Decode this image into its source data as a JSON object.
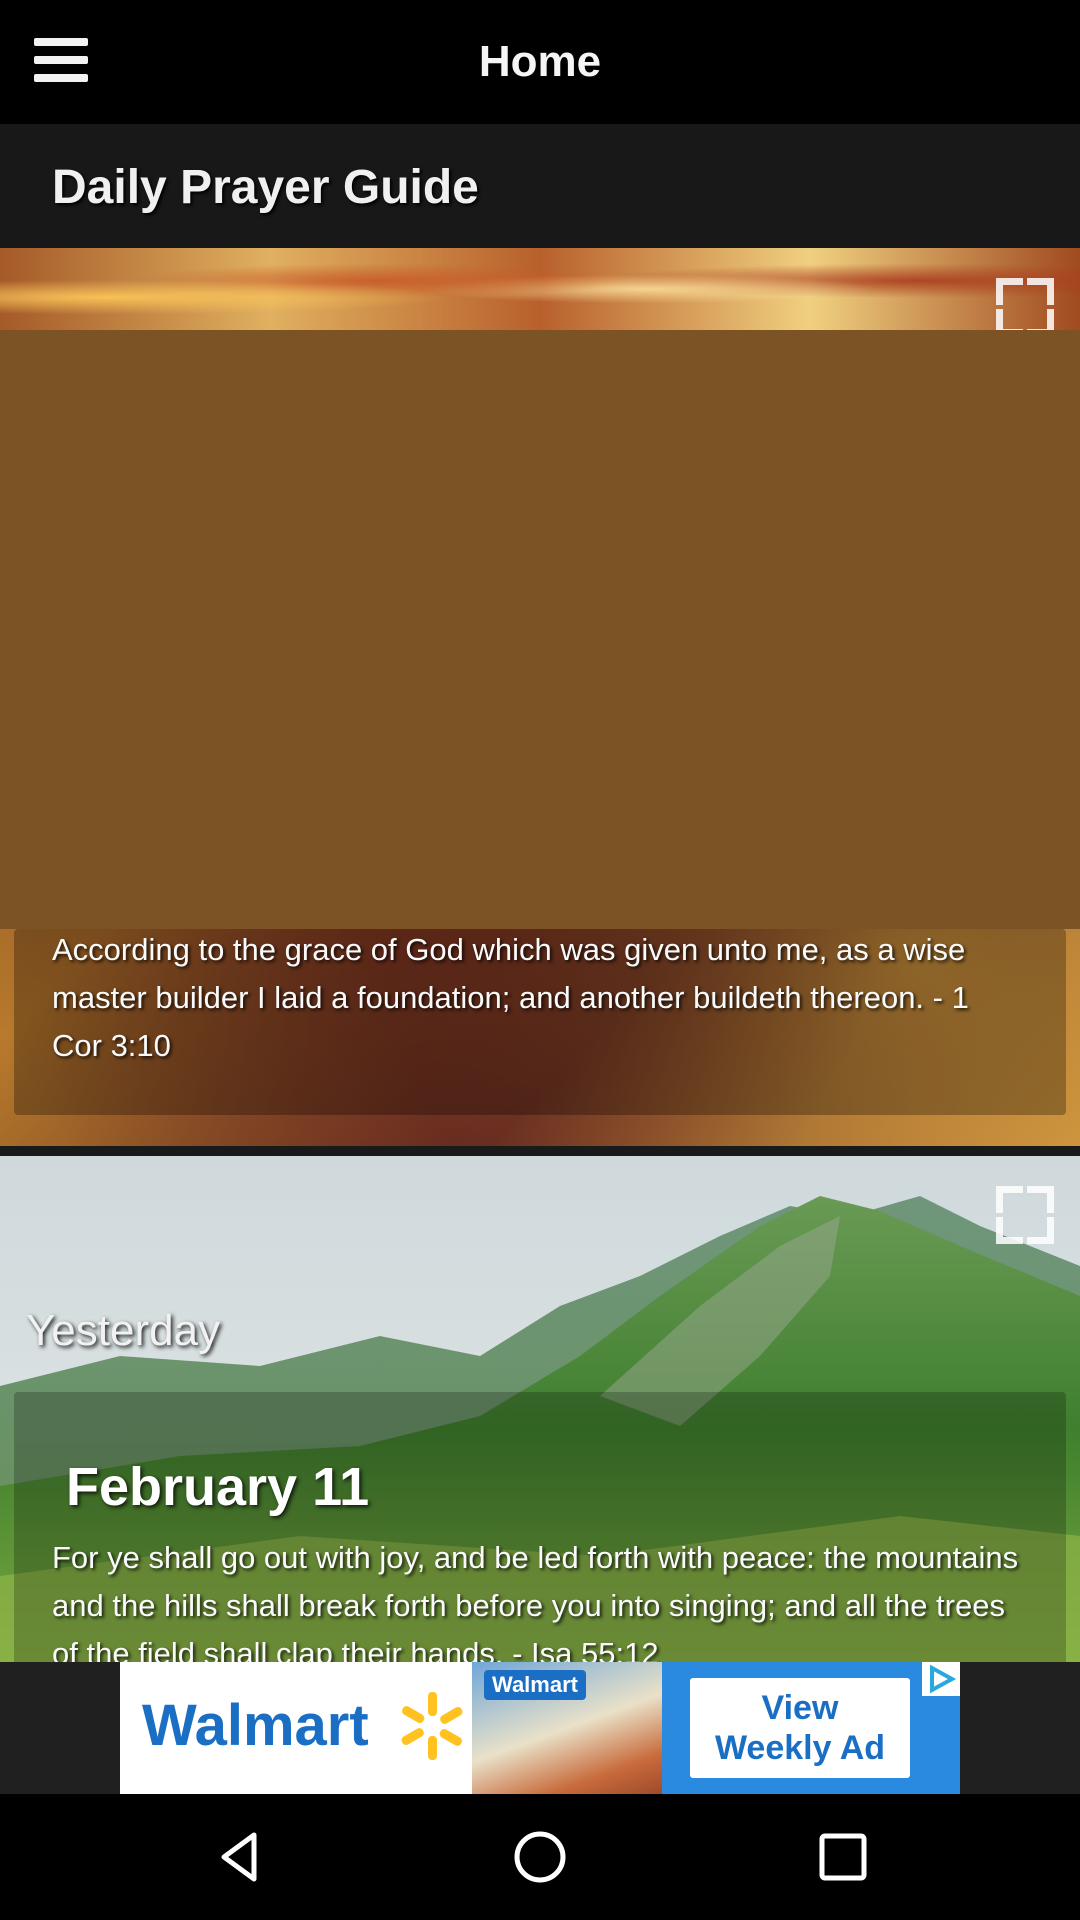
{
  "app_bar": {
    "title": "Home",
    "menu_icon": "hamburger-menu-icon"
  },
  "section": {
    "title": "Daily Prayer Guide"
  },
  "cards": [
    {
      "quote": "According to the grace of God which was given unto me, as a wise master builder I laid a foundation; and another buildeth thereon. - 1 Cor 3:10",
      "expand_icon": "fullscreen-icon"
    },
    {
      "label": "Yesterday",
      "date": "February 11",
      "quote": "For ye shall go out with joy, and be led forth with peace: the mountains and the hills shall break forth before you into singing; and all the trees of the field shall clap their hands. - Isa 55:12",
      "expand_icon": "fullscreen-icon"
    }
  ],
  "ad": {
    "brand": "Walmart",
    "photo_label": "Walmart",
    "cta": "View\nWeekly Ad",
    "colors": {
      "brand_blue": "#1a6fc4",
      "spark_yellow": "#ffc220",
      "panel_blue": "#2a8adf"
    }
  },
  "nav": {
    "back_icon": "back-icon",
    "home_icon": "home-icon",
    "recents_icon": "recents-icon"
  }
}
